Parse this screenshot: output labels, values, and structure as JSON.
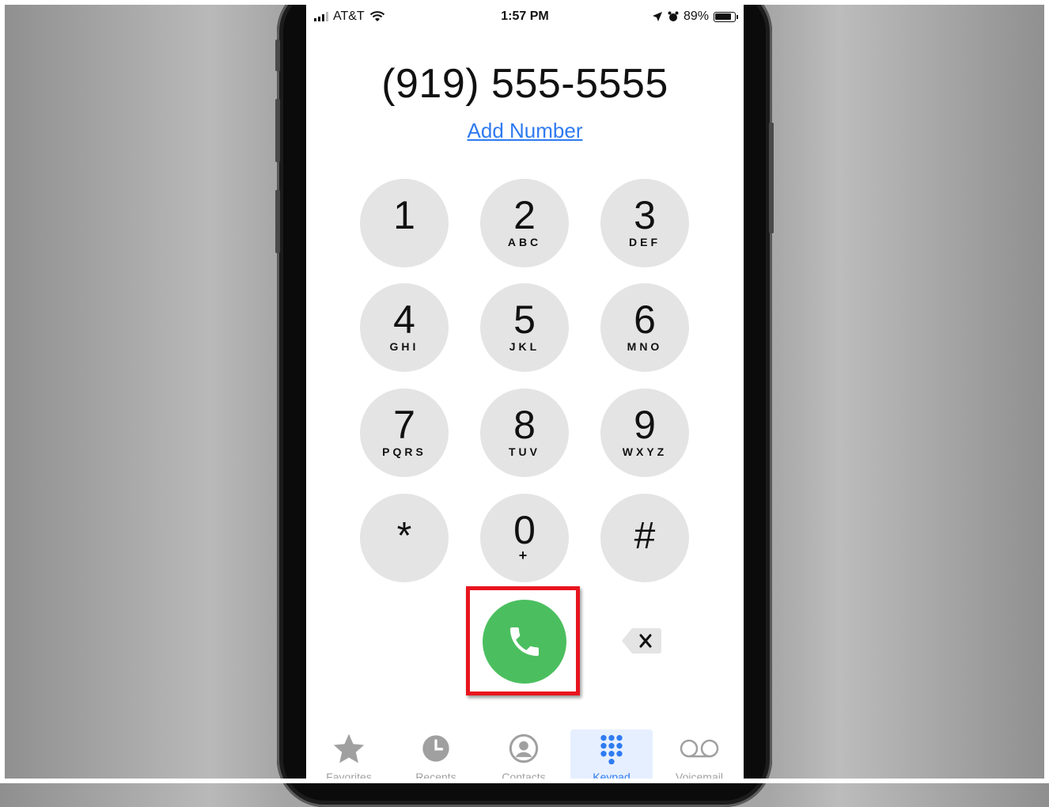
{
  "status_bar": {
    "carrier": "AT&T",
    "time": "1:57 PM",
    "battery": "89%",
    "battery_level": 0.89,
    "icons": [
      "signal-icon",
      "wifi-icon",
      "location-icon",
      "alarm-icon",
      "battery-icon"
    ]
  },
  "dialer": {
    "number": "(919) 555-5555",
    "add_number_label": "Add Number",
    "keys": [
      {
        "digit": "1",
        "letters": ""
      },
      {
        "digit": "2",
        "letters": "ABC"
      },
      {
        "digit": "3",
        "letters": "DEF"
      },
      {
        "digit": "4",
        "letters": "GHI"
      },
      {
        "digit": "5",
        "letters": "JKL"
      },
      {
        "digit": "6",
        "letters": "MNO"
      },
      {
        "digit": "7",
        "letters": "PQRS"
      },
      {
        "digit": "8",
        "letters": "TUV"
      },
      {
        "digit": "9",
        "letters": "WXYZ"
      },
      {
        "digit": "*",
        "letters": ""
      },
      {
        "digit": "0",
        "letters": "+"
      },
      {
        "digit": "#",
        "letters": ""
      }
    ],
    "call_icon": "phone-icon",
    "delete_icon": "backspace-icon"
  },
  "tab_bar": {
    "tabs": [
      {
        "label": "Favorites",
        "icon": "star-icon",
        "active": false
      },
      {
        "label": "Recents",
        "icon": "clock-icon",
        "active": false
      },
      {
        "label": "Contacts",
        "icon": "person-icon",
        "active": false
      },
      {
        "label": "Keypad",
        "icon": "keypad-icon",
        "active": true
      },
      {
        "label": "Voicemail",
        "icon": "voicemail-icon",
        "active": false
      }
    ]
  },
  "colors": {
    "call_green": "#4bbf5f",
    "accent_blue": "#2f7bf0",
    "highlight_red": "#e8141e",
    "key_gray": "#e4e4e4"
  }
}
